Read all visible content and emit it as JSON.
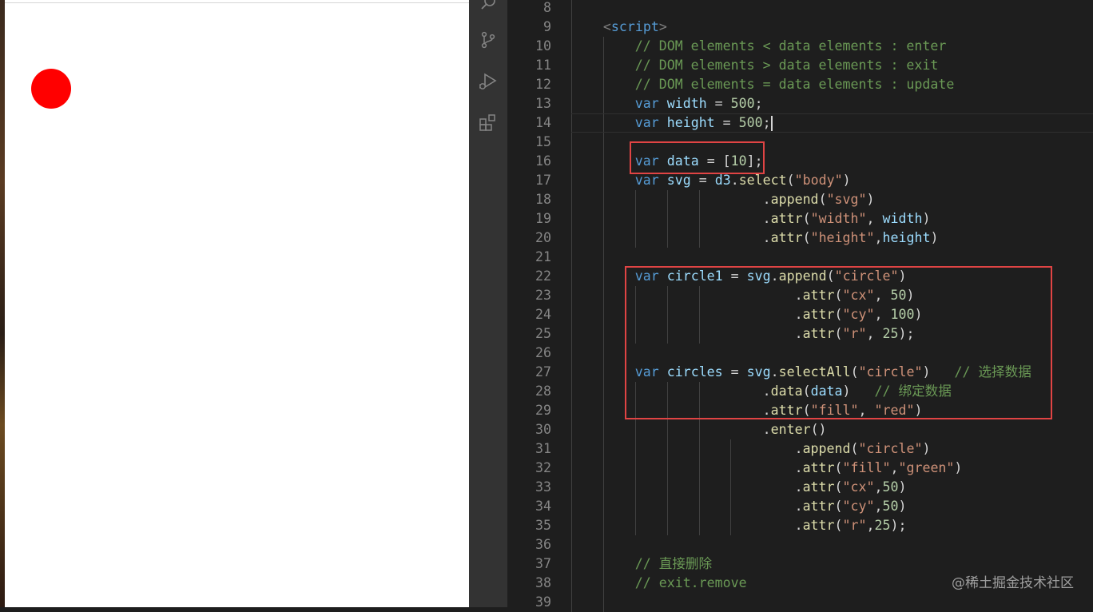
{
  "preview": {
    "circle": {
      "color": "#ff0000"
    }
  },
  "activity_bar": {
    "icons": [
      "search-icon",
      "source-control-icon",
      "run-debug-icon",
      "extensions-icon"
    ]
  },
  "editor": {
    "lines": [
      {
        "n": "8",
        "tokens": []
      },
      {
        "n": "9",
        "tokens": [
          {
            "t": "<",
            "c": "tag"
          },
          {
            "t": "script",
            "c": "tagname"
          },
          {
            "t": ">",
            "c": "tag"
          }
        ]
      },
      {
        "n": "10",
        "tokens": [
          {
            "t": "// DOM elements < data elements : enter",
            "c": "cm"
          }
        ]
      },
      {
        "n": "11",
        "tokens": [
          {
            "t": "// DOM elements > data elements : exit",
            "c": "cm"
          }
        ]
      },
      {
        "n": "12",
        "tokens": [
          {
            "t": "// DOM elements = data elements : update",
            "c": "cm"
          }
        ]
      },
      {
        "n": "13",
        "tokens": [
          {
            "t": "var",
            "c": "kw"
          },
          {
            "t": " ",
            "c": "pl"
          },
          {
            "t": "width",
            "c": "var"
          },
          {
            "t": " = ",
            "c": "pl"
          },
          {
            "t": "500",
            "c": "num"
          },
          {
            "t": ";",
            "c": "pl"
          }
        ]
      },
      {
        "n": "14",
        "tokens": [
          {
            "t": "var",
            "c": "kw"
          },
          {
            "t": " ",
            "c": "pl"
          },
          {
            "t": "height",
            "c": "var"
          },
          {
            "t": " = ",
            "c": "pl"
          },
          {
            "t": "500",
            "c": "num"
          },
          {
            "t": ";",
            "c": "pl"
          }
        ]
      },
      {
        "n": "15",
        "tokens": []
      },
      {
        "n": "16",
        "tokens": [
          {
            "t": "var",
            "c": "kw"
          },
          {
            "t": " ",
            "c": "pl"
          },
          {
            "t": "data",
            "c": "var"
          },
          {
            "t": " = [",
            "c": "pl"
          },
          {
            "t": "10",
            "c": "num"
          },
          {
            "t": "];",
            "c": "pl"
          }
        ]
      },
      {
        "n": "17",
        "tokens": [
          {
            "t": "var",
            "c": "kw"
          },
          {
            "t": " ",
            "c": "pl"
          },
          {
            "t": "svg",
            "c": "var"
          },
          {
            "t": " = ",
            "c": "pl"
          },
          {
            "t": "d3",
            "c": "var"
          },
          {
            "t": ".",
            "c": "pl"
          },
          {
            "t": "select",
            "c": "fn"
          },
          {
            "t": "(",
            "c": "pl"
          },
          {
            "t": "\"body\"",
            "c": "str"
          },
          {
            "t": ")",
            "c": "pl"
          }
        ]
      },
      {
        "n": "18",
        "tokens": [
          {
            "t": "                ",
            "c": "pl"
          },
          {
            "t": ".",
            "c": "pl"
          },
          {
            "t": "append",
            "c": "fn"
          },
          {
            "t": "(",
            "c": "pl"
          },
          {
            "t": "\"svg\"",
            "c": "str"
          },
          {
            "t": ")",
            "c": "pl"
          }
        ]
      },
      {
        "n": "19",
        "tokens": [
          {
            "t": "                ",
            "c": "pl"
          },
          {
            "t": ".",
            "c": "pl"
          },
          {
            "t": "attr",
            "c": "fn"
          },
          {
            "t": "(",
            "c": "pl"
          },
          {
            "t": "\"width\"",
            "c": "str"
          },
          {
            "t": ", ",
            "c": "pl"
          },
          {
            "t": "width",
            "c": "var"
          },
          {
            "t": ")",
            "c": "pl"
          }
        ]
      },
      {
        "n": "20",
        "tokens": [
          {
            "t": "                ",
            "c": "pl"
          },
          {
            "t": ".",
            "c": "pl"
          },
          {
            "t": "attr",
            "c": "fn"
          },
          {
            "t": "(",
            "c": "pl"
          },
          {
            "t": "\"height\"",
            "c": "str"
          },
          {
            "t": ",",
            "c": "pl"
          },
          {
            "t": "height",
            "c": "var"
          },
          {
            "t": ")",
            "c": "pl"
          }
        ]
      },
      {
        "n": "21",
        "tokens": []
      },
      {
        "n": "22",
        "tokens": [
          {
            "t": "var",
            "c": "kw"
          },
          {
            "t": " ",
            "c": "pl"
          },
          {
            "t": "circle1",
            "c": "var"
          },
          {
            "t": " = ",
            "c": "pl"
          },
          {
            "t": "svg",
            "c": "var"
          },
          {
            "t": ".",
            "c": "pl"
          },
          {
            "t": "append",
            "c": "fn"
          },
          {
            "t": "(",
            "c": "pl"
          },
          {
            "t": "\"circle\"",
            "c": "str"
          },
          {
            "t": ")",
            "c": "pl"
          }
        ]
      },
      {
        "n": "23",
        "tokens": [
          {
            "t": "                    ",
            "c": "pl"
          },
          {
            "t": ".",
            "c": "pl"
          },
          {
            "t": "attr",
            "c": "fn"
          },
          {
            "t": "(",
            "c": "pl"
          },
          {
            "t": "\"cx\"",
            "c": "str"
          },
          {
            "t": ", ",
            "c": "pl"
          },
          {
            "t": "50",
            "c": "num"
          },
          {
            "t": ")",
            "c": "pl"
          }
        ]
      },
      {
        "n": "24",
        "tokens": [
          {
            "t": "                    ",
            "c": "pl"
          },
          {
            "t": ".",
            "c": "pl"
          },
          {
            "t": "attr",
            "c": "fn"
          },
          {
            "t": "(",
            "c": "pl"
          },
          {
            "t": "\"cy\"",
            "c": "str"
          },
          {
            "t": ", ",
            "c": "pl"
          },
          {
            "t": "100",
            "c": "num"
          },
          {
            "t": ")",
            "c": "pl"
          }
        ]
      },
      {
        "n": "25",
        "tokens": [
          {
            "t": "                    ",
            "c": "pl"
          },
          {
            "t": ".",
            "c": "pl"
          },
          {
            "t": "attr",
            "c": "fn"
          },
          {
            "t": "(",
            "c": "pl"
          },
          {
            "t": "\"r\"",
            "c": "str"
          },
          {
            "t": ", ",
            "c": "pl"
          },
          {
            "t": "25",
            "c": "num"
          },
          {
            "t": ");",
            "c": "pl"
          }
        ]
      },
      {
        "n": "26",
        "tokens": []
      },
      {
        "n": "27",
        "tokens": [
          {
            "t": "var",
            "c": "kw"
          },
          {
            "t": " ",
            "c": "pl"
          },
          {
            "t": "circles",
            "c": "var"
          },
          {
            "t": " = ",
            "c": "pl"
          },
          {
            "t": "svg",
            "c": "var"
          },
          {
            "t": ".",
            "c": "pl"
          },
          {
            "t": "selectAll",
            "c": "fn"
          },
          {
            "t": "(",
            "c": "pl"
          },
          {
            "t": "\"circle\"",
            "c": "str"
          },
          {
            "t": ")   ",
            "c": "pl"
          },
          {
            "t": "// 选择数据",
            "c": "cm"
          }
        ]
      },
      {
        "n": "28",
        "tokens": [
          {
            "t": "                ",
            "c": "pl"
          },
          {
            "t": ".",
            "c": "pl"
          },
          {
            "t": "data",
            "c": "fn"
          },
          {
            "t": "(",
            "c": "pl"
          },
          {
            "t": "data",
            "c": "var"
          },
          {
            "t": ")   ",
            "c": "pl"
          },
          {
            "t": "// 绑定数据",
            "c": "cm"
          }
        ]
      },
      {
        "n": "29",
        "tokens": [
          {
            "t": "                ",
            "c": "pl"
          },
          {
            "t": ".",
            "c": "pl"
          },
          {
            "t": "attr",
            "c": "fn"
          },
          {
            "t": "(",
            "c": "pl"
          },
          {
            "t": "\"fill\"",
            "c": "str"
          },
          {
            "t": ", ",
            "c": "pl"
          },
          {
            "t": "\"red\"",
            "c": "str"
          },
          {
            "t": ")",
            "c": "pl"
          }
        ]
      },
      {
        "n": "30",
        "tokens": [
          {
            "t": "                ",
            "c": "pl"
          },
          {
            "t": ".",
            "c": "pl"
          },
          {
            "t": "enter",
            "c": "fn"
          },
          {
            "t": "()",
            "c": "pl"
          }
        ]
      },
      {
        "n": "31",
        "tokens": [
          {
            "t": "                    ",
            "c": "pl"
          },
          {
            "t": ".",
            "c": "pl"
          },
          {
            "t": "append",
            "c": "fn"
          },
          {
            "t": "(",
            "c": "pl"
          },
          {
            "t": "\"circle\"",
            "c": "str"
          },
          {
            "t": ")",
            "c": "pl"
          }
        ]
      },
      {
        "n": "32",
        "tokens": [
          {
            "t": "                    ",
            "c": "pl"
          },
          {
            "t": ".",
            "c": "pl"
          },
          {
            "t": "attr",
            "c": "fn"
          },
          {
            "t": "(",
            "c": "pl"
          },
          {
            "t": "\"fill\"",
            "c": "str"
          },
          {
            "t": ",",
            "c": "pl"
          },
          {
            "t": "\"green\"",
            "c": "str"
          },
          {
            "t": ")",
            "c": "pl"
          }
        ]
      },
      {
        "n": "33",
        "tokens": [
          {
            "t": "                    ",
            "c": "pl"
          },
          {
            "t": ".",
            "c": "pl"
          },
          {
            "t": "attr",
            "c": "fn"
          },
          {
            "t": "(",
            "c": "pl"
          },
          {
            "t": "\"cx\"",
            "c": "str"
          },
          {
            "t": ",",
            "c": "pl"
          },
          {
            "t": "50",
            "c": "num"
          },
          {
            "t": ")",
            "c": "pl"
          }
        ]
      },
      {
        "n": "34",
        "tokens": [
          {
            "t": "                    ",
            "c": "pl"
          },
          {
            "t": ".",
            "c": "pl"
          },
          {
            "t": "attr",
            "c": "fn"
          },
          {
            "t": "(",
            "c": "pl"
          },
          {
            "t": "\"cy\"",
            "c": "str"
          },
          {
            "t": ",",
            "c": "pl"
          },
          {
            "t": "50",
            "c": "num"
          },
          {
            "t": ")",
            "c": "pl"
          }
        ]
      },
      {
        "n": "35",
        "tokens": [
          {
            "t": "                    ",
            "c": "pl"
          },
          {
            "t": ".",
            "c": "pl"
          },
          {
            "t": "attr",
            "c": "fn"
          },
          {
            "t": "(",
            "c": "pl"
          },
          {
            "t": "\"r\"",
            "c": "str"
          },
          {
            "t": ",",
            "c": "pl"
          },
          {
            "t": "25",
            "c": "num"
          },
          {
            "t": ");",
            "c": "pl"
          }
        ]
      },
      {
        "n": "36",
        "tokens": []
      },
      {
        "n": "37",
        "tokens": [
          {
            "t": "// 直接删除",
            "c": "cm"
          }
        ]
      },
      {
        "n": "38",
        "tokens": [
          {
            "t": "// exit.remove",
            "c": "cm"
          }
        ]
      },
      {
        "n": "39",
        "tokens": []
      }
    ]
  },
  "watermark": "@稀土掘金技术社区"
}
